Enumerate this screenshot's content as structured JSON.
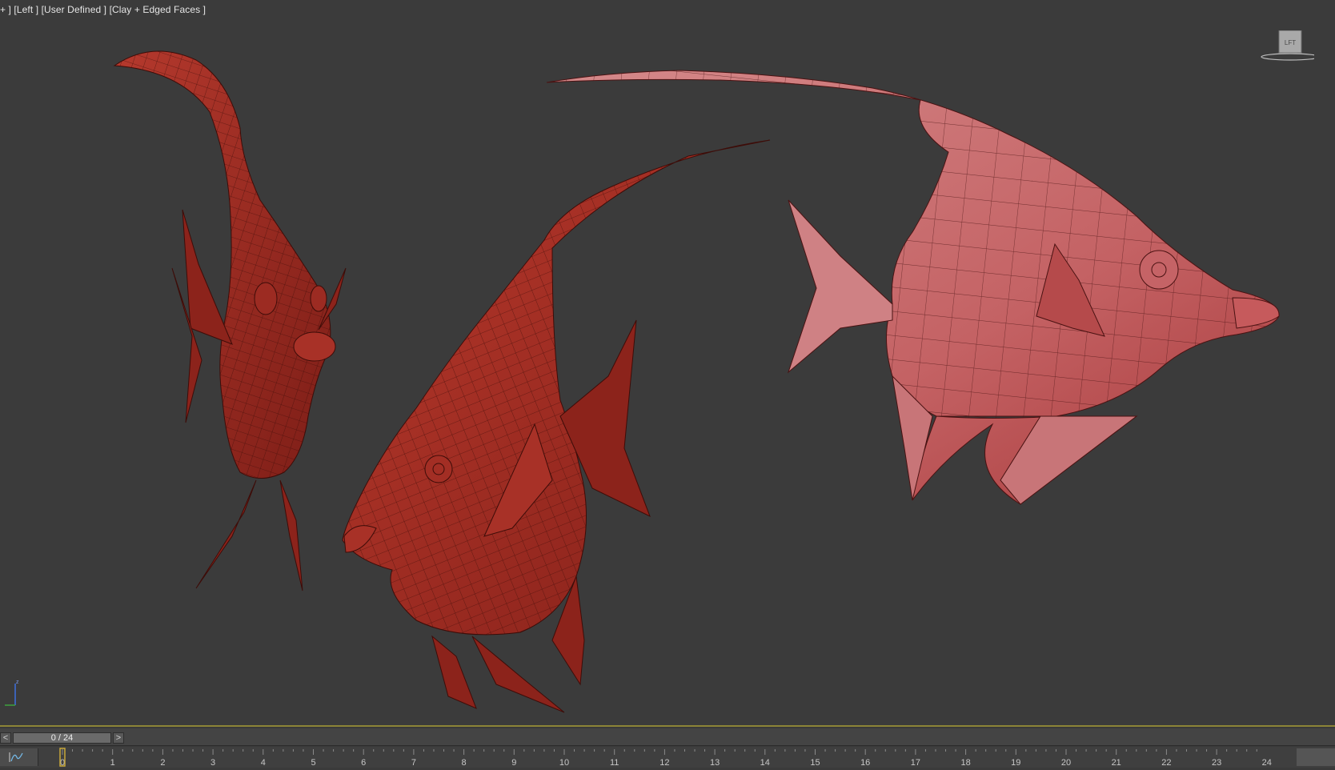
{
  "viewport": {
    "label_parts": [
      "+ ]",
      "[Left ]",
      "[User Defined ]",
      "[Clay + Edged Faces ]"
    ],
    "viewcube_face": "LFT",
    "axis_label": "z"
  },
  "time_slider": {
    "prev_label": "<",
    "position_label": "0 / 24",
    "next_label": ">"
  },
  "track_bar": {
    "frames": [
      "0",
      "1",
      "2",
      "3",
      "4",
      "5",
      "6",
      "7",
      "8",
      "9",
      "10",
      "11",
      "12",
      "13",
      "14",
      "15",
      "16",
      "17",
      "18",
      "19",
      "20",
      "21",
      "22",
      "23",
      "24"
    ],
    "current_frame": 0,
    "curve_editor_icon": "curve-editor-icon"
  },
  "colors": {
    "model_dark": "#9c2b22",
    "model_light": "#c9696a",
    "wire": "#3a0e0b",
    "timeline_accent": "#8c8436",
    "frame_marker": "#c8a83a"
  }
}
